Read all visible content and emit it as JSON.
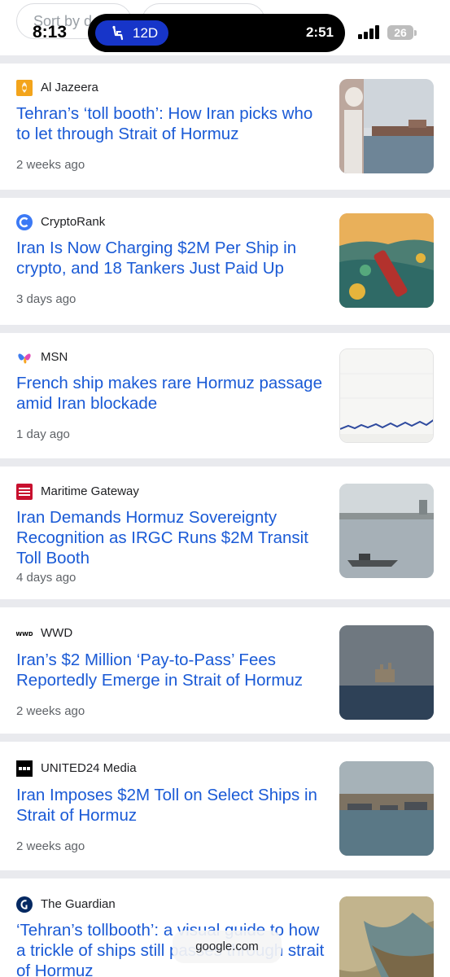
{
  "status_bar": {
    "time": "8:13",
    "live_activity": {
      "seat": "12D",
      "timer": "2:51"
    },
    "battery": "26"
  },
  "filter_chips": {
    "sort_label": "Sort by d"
  },
  "articles": [
    {
      "source": "Al Jazeera",
      "icon": "al-jazeera-logo-icon",
      "title": "Tehran’s ‘toll booth’: How Iran picks who to let through Strait of Hormuz",
      "age": "2 weeks ago"
    },
    {
      "source": "CryptoRank",
      "icon": "cryptorank-logo-icon",
      "title": "Iran Is Now Charging $2M Per Ship in crypto, and 18 Tankers Just Paid Up",
      "age": "3 days ago"
    },
    {
      "source": "MSN",
      "icon": "msn-logo-icon",
      "title": "French ship makes rare Hormuz passage amid Iran blockade",
      "age": "1 day ago"
    },
    {
      "source": "Maritime Gateway",
      "icon": "maritime-gateway-logo-icon",
      "title": "Iran Demands Hormuz Sovereignty Recognition as IRGC Runs $2M Transit Toll Booth",
      "age": "4 days ago"
    },
    {
      "source": "WWD",
      "icon": "wwd-logo-icon",
      "title": "Iran’s $2 Million ‘Pay-to-Pass’ Fees Reportedly Emerge in Strait of Hormuz",
      "age": "2 weeks ago"
    },
    {
      "source": "UNITED24 Media",
      "icon": "united24-logo-icon",
      "title": "Iran Imposes $2M Toll on Select Ships in Strait of Hormuz",
      "age": "2 weeks ago"
    },
    {
      "source": "The Guardian",
      "icon": "guardian-logo-icon",
      "title": "‘Tehran’s tollbooth’: a visual guide to how a trickle of ships still passes through strait of Hormuz",
      "age": ""
    }
  ],
  "bottom_bar": {
    "domain": "google.com"
  },
  "colors": {
    "headline": "#1a5ad6",
    "source": "#202124",
    "age": "#5f6368",
    "background": "#e9eaee",
    "card": "#ffffff"
  }
}
